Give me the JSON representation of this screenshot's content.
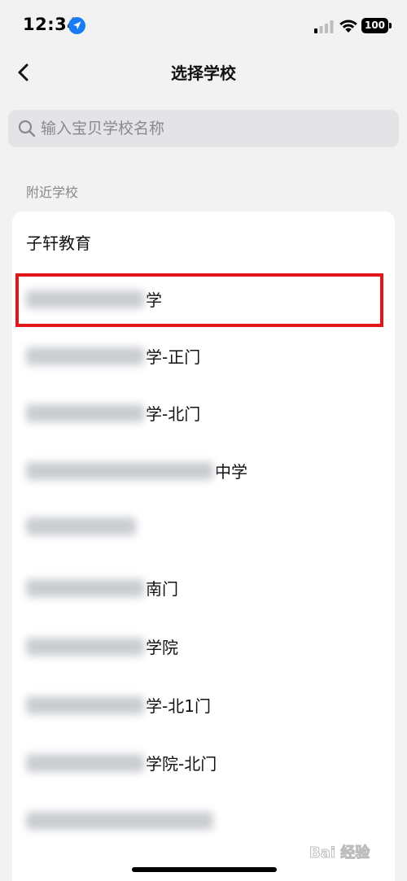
{
  "status_bar": {
    "time": "12:34",
    "battery": "100"
  },
  "nav": {
    "title": "选择学校"
  },
  "search": {
    "placeholder": "输入宝贝学校名称",
    "value": ""
  },
  "section": {
    "header": "附近学校"
  },
  "schools": [
    {
      "suffix": "子轩教育"
    },
    {
      "suffix": "学"
    },
    {
      "suffix": "学-正门"
    },
    {
      "suffix": "学-北门"
    },
    {
      "suffix": "中学"
    },
    {
      "suffix": ""
    },
    {
      "suffix": "南门"
    },
    {
      "suffix": "学院"
    },
    {
      "suffix": "学-北1门"
    },
    {
      "suffix": "学院-北门"
    },
    {
      "suffix": ""
    }
  ],
  "colors": {
    "highlight": "#e0161a",
    "background": "#f2f2f2",
    "search_bg": "#e4e4e6"
  },
  "watermark": "Bai 经验"
}
